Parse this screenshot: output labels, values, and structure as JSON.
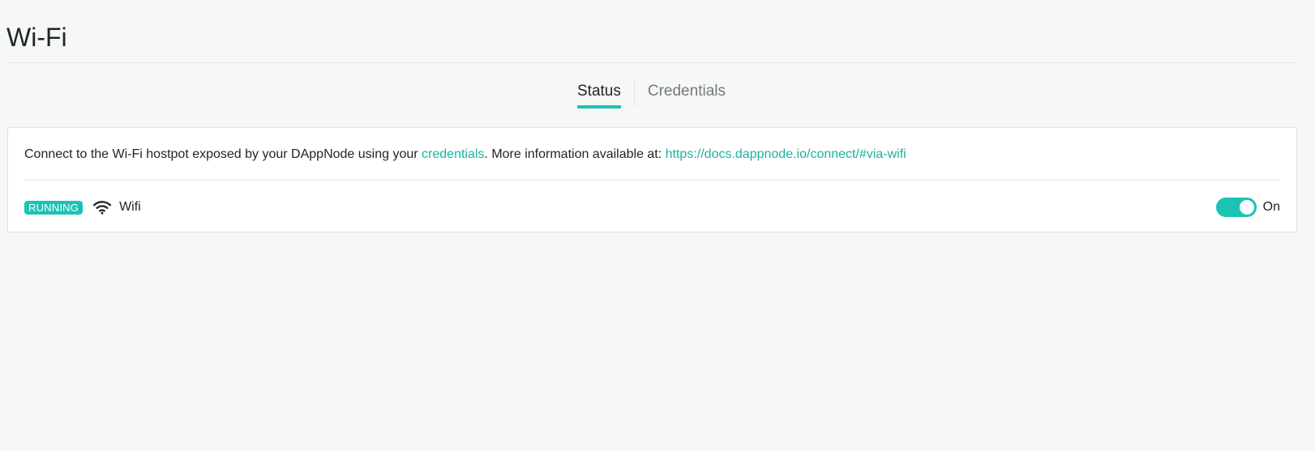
{
  "page": {
    "title": "Wi-Fi"
  },
  "tabs": [
    {
      "label": "Status",
      "active": true
    },
    {
      "label": "Credentials",
      "active": false
    }
  ],
  "info": {
    "text_before": "Connect to the Wi-Fi hostpot exposed by your DAppNode using your ",
    "credentials_link": "credentials",
    "text_middle": ". More information available at: ",
    "docs_link": "https://docs.dappnode.io/connect/#via-wifi"
  },
  "service": {
    "status_badge": "RUNNING",
    "icon": "wifi-icon",
    "name": "Wifi",
    "toggle_state": "On",
    "toggle_on": true
  },
  "colors": {
    "accent": "#1bc3b4",
    "link": "#1bb3a3",
    "background": "#f6f7f7",
    "text": "#212529",
    "muted_tab": "#74787c"
  }
}
